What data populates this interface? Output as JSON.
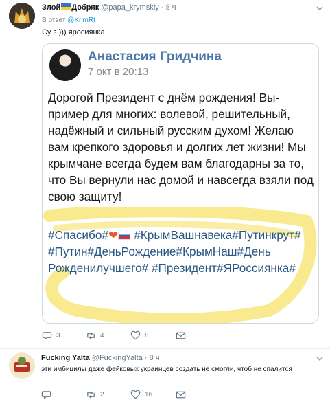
{
  "tweet1": {
    "name": "Злой",
    "name_suffix": "Добряк",
    "handle": "@papa_krymskiy",
    "dot": "·",
    "time": "8 ч",
    "reply_prefix": "В ответ",
    "reply_mention": "@KrimRt",
    "text": "Су  з ))) яросиянка",
    "media": {
      "author": "Анастасия Гридчина",
      "date": "7 окт в 20:13",
      "body": "Дорогой Президент с днём рождения! Вы-пример для многих: волевой, решительный, надёжный и сильный русским духом! Желаю вам крепкого здоровья и долгих лет жизни! Мы крымчане всегда будем вам благодарны за то, что Вы вернули нас домой и навсегда взяли под свою защиту!",
      "tag_spasibo": "#Спасибо#",
      "heart": "❤",
      "tags_rest": "#КрымВашнавека#Путинкрут# #Путин#ДеньРождение#КрымНаш#День Рожденилучшего# #Президент#ЯРоссиянка#"
    },
    "actions": {
      "replies": "3",
      "retweets": "4",
      "likes": "8"
    }
  },
  "tweet2": {
    "name": "Fucking Yalta",
    "handle": "@FuckingYalta",
    "dot": "·",
    "time": "8 ч",
    "text": "эти имбицилы даже фейковых украинцев создать не смогли, чтоб не спалится",
    "actions": {
      "replies": "",
      "retweets": "2",
      "likes": "16"
    }
  },
  "colors": {
    "link": "#1b95e0",
    "muted": "#657786",
    "vk_blue": "#4a76a8",
    "highlight": "#f7e36a"
  },
  "icons": [
    "reply-icon",
    "retweet-icon",
    "like-icon",
    "dm-icon",
    "chevron-down-icon"
  ]
}
